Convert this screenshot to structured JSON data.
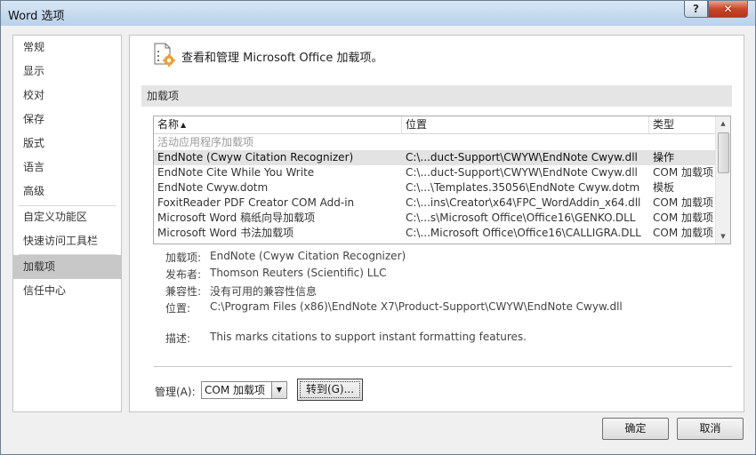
{
  "window": {
    "title": "Word 选项",
    "help_label": "?",
    "close_label": "✕"
  },
  "nav": {
    "items": [
      {
        "label": "常规"
      },
      {
        "label": "显示"
      },
      {
        "label": "校对"
      },
      {
        "label": "保存"
      },
      {
        "label": "版式"
      },
      {
        "label": "语言"
      },
      {
        "label": "高级"
      },
      {
        "label": "自定义功能区"
      },
      {
        "label": "快速访问工具栏"
      },
      {
        "label": "加载项",
        "selected": true
      },
      {
        "label": "信任中心"
      }
    ]
  },
  "content": {
    "header": "查看和管理 Microsoft Office 加载项。",
    "header_icon": "addins-settings-icon",
    "section_title": "加载项",
    "list": {
      "columns": [
        "名称",
        "位置",
        "类型"
      ],
      "sort_indicator": "▲",
      "group_label": "活动应用程序加载项",
      "rows": [
        {
          "name": "EndNote (Cwyw Citation Recognizer)",
          "location": "C:\\...duct-Support\\CWYW\\EndNote Cwyw.dll",
          "type": "操作",
          "selected": true
        },
        {
          "name": "EndNote Cite While You Write",
          "location": "C:\\...duct-Support\\CWYW\\EndNote Cwyw.dll",
          "type": "COM 加载项"
        },
        {
          "name": "EndNote Cwyw.dotm",
          "location": "C:\\...\\Templates.35056\\EndNote Cwyw.dotm",
          "type": "模板"
        },
        {
          "name": "FoxitReader PDF Creator COM Add-in",
          "location": "C:\\...ins\\Creator\\x64\\FPC_WordAddin_x64.dll",
          "type": "COM 加载项"
        },
        {
          "name": "Microsoft Word 稿纸向导加载项",
          "location": "C:\\...s\\Microsoft Office\\Office16\\GENKO.DLL",
          "type": "COM 加载项"
        },
        {
          "name": "Microsoft Word 书法加载项",
          "location": "C:\\...Microsoft Office\\Office16\\CALLIGRA.DLL",
          "type": "COM 加载项"
        }
      ]
    },
    "details": {
      "addin_label": "加载项:",
      "addin_value": "EndNote (Cwyw Citation Recognizer)",
      "publisher_label": "发布者:",
      "publisher_value": "Thomson Reuters (Scientific) LLC",
      "compat_label": "兼容性:",
      "compat_value": "没有可用的兼容性信息",
      "location_label": "位置:",
      "location_value": "C:\\Program Files (x86)\\EndNote X7\\Product-Support\\CWYW\\EndNote Cwyw.dll",
      "desc_label": "描述:",
      "desc_value": "This marks citations to support instant formatting features."
    },
    "manage": {
      "label": "管理(A):",
      "selected": "COM 加载项",
      "goto_label": "转到(G)..."
    }
  },
  "footer": {
    "ok_label": "确定",
    "cancel_label": "取消"
  },
  "colors": {
    "selected_nav": "#c8c8c8",
    "selected_row": "#e3e3e3",
    "section_bar": "#e5e5e5",
    "close_button": "#c9462b"
  }
}
